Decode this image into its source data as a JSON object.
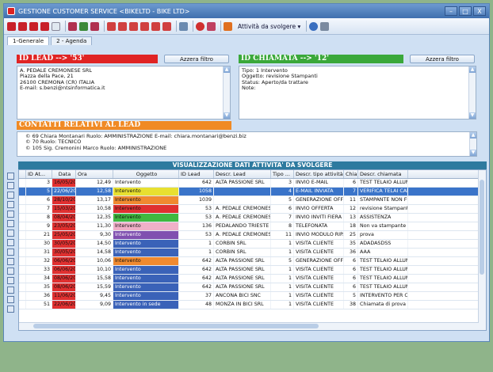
{
  "window": {
    "title": "GESTIONE CUSTOMER SERVICE <BIKELTD - BIKE LTD>",
    "min": "–",
    "max": "□",
    "close": "X"
  },
  "toolbar": {
    "menu_label": "Attività da svolgere ▾"
  },
  "tabs": [
    {
      "label": "1-Generale"
    },
    {
      "label": "2 - Agenda"
    }
  ],
  "id_lead": {
    "header": "ID LEAD --> '53'",
    "filter_label": "Azzera filtro",
    "lines": [
      "A. PEDALE CREMONESE SRL",
      "Piazza della Pace, 21",
      "26100 CREMONA (CR) ITALIA",
      "E-mail: s.benzi@ntsinformatica.it"
    ]
  },
  "id_chiamata": {
    "header": "ID CHIAMATA --> '12'",
    "filter_label": "Azzera filtro",
    "lines": [
      "Tipo: 1 Intervento",
      "Oggetto: revisione Stampanti",
      "Status: Aperto/da trattare",
      "Note:"
    ]
  },
  "contatti": {
    "header": "CONTATTI RELATIVI AL LEAD",
    "lines": [
      "69 Chiara  Montanari Ruolo: AMMINISTRAZIONE E-mail: chiara.montanari@benzi.biz",
      "70  Ruolo: TECNICO",
      "105 Sig. Cremonini Marco Ruolo: AMMINISTRAZIONE"
    ]
  },
  "grid": {
    "title": "VISUALIZZAZIONE DATI ATTIVITA' DA SVOLGERE",
    "columns": [
      "",
      "ID At...",
      "Data",
      "Ora",
      "Oggetto",
      "ID Lead",
      "Descr. Lead",
      "Tipo ...",
      "Descr. tipo attività",
      "Chia...",
      "Descr. chiamata"
    ],
    "rows": [
      {
        "id": "3",
        "data": "16/05/2012",
        "ora": "12,49",
        "oggetto": "Intervento",
        "idlead": "642",
        "lead": "ALTA PASSIONE SRL",
        "tipo": "3",
        "tipodesc": "INVIO E-MAIL",
        "chia": "6",
        "chiadesc": "TEST TELAIO ALLUMINIO",
        "datecolor": "#e03030",
        "ogcolor": ""
      },
      {
        "id": "5",
        "data": "22/06/2010",
        "ora": "12,58",
        "oggetto": "Intervento",
        "idlead": "1058",
        "lead": "",
        "tipo": "4",
        "tipodesc": "E-MAIL INVIATA",
        "chia": "7",
        "chiadesc": "VERIFICA TELAI CARBONI",
        "datecolor": "#e03030",
        "ogcolor": "#e8e030",
        "sel": true
      },
      {
        "id": "6",
        "data": "28/10/2010",
        "ora": "13,17",
        "oggetto": "Intervento",
        "idlead": "1039",
        "lead": "",
        "tipo": "5",
        "tipodesc": "GENERAZIONE OFFERTA",
        "chia": "11",
        "chiadesc": "STAMPANTE NON FUNZIO",
        "datecolor": "#e03030",
        "ogcolor": "#f08a30"
      },
      {
        "id": "7",
        "data": "15/03/2011",
        "ora": "10,58",
        "oggetto": "Intervento",
        "idlead": "53",
        "lead": "A. PEDALE CREMONESE SRL",
        "tipo": "6",
        "tipodesc": "INVIO OFFERTA",
        "chia": "12",
        "chiadesc": "revisione Stampanti",
        "datecolor": "#e03030",
        "ogcolor": "#e03030"
      },
      {
        "id": "8",
        "data": "08/04/2011",
        "ora": "12,35",
        "oggetto": "Intervento",
        "idlead": "53",
        "lead": "A. PEDALE CREMONESE SRL",
        "tipo": "7",
        "tipodesc": "INVIO INVITI FIERA",
        "chia": "13",
        "chiadesc": "ASSISTENZA",
        "datecolor": "#e03030",
        "ogcolor": "#40b840"
      },
      {
        "id": "9",
        "data": "23/05/2012",
        "ora": "11,30",
        "oggetto": "Intervento",
        "idlead": "136",
        "lead": "PEDALANDO TRIESTE SRL",
        "tipo": "8",
        "tipodesc": "TELEFONATA",
        "chia": "18",
        "chiadesc": "Non va stampante",
        "datecolor": "#e03030",
        "ogcolor": "#f0b0c8"
      },
      {
        "id": "21",
        "data": "25/05/2012",
        "ora": "9,30",
        "oggetto": "Intervento",
        "idlead": "53",
        "lead": "A. PEDALE CREMONESE SRL",
        "tipo": "11",
        "tipodesc": "INVIO MODULO RIPARAZION",
        "chia": "25",
        "chiadesc": "prova",
        "datecolor": "#e03030",
        "ogcolor": "#8050b0"
      },
      {
        "id": "30",
        "data": "30/05/2012",
        "ora": "14,50",
        "oggetto": "Intervento",
        "idlead": "1",
        "lead": "CORBIN SRL",
        "tipo": "1",
        "tipodesc": "VISITA CLIENTE",
        "chia": "35",
        "chiadesc": "ADADASDSS",
        "datecolor": "#e03030",
        "ogcolor": "#3a62b8"
      },
      {
        "id": "31",
        "data": "30/05/2012",
        "ora": "14,58",
        "oggetto": "Intervento",
        "idlead": "1",
        "lead": "CORBIN SRL",
        "tipo": "1",
        "tipodesc": "VISITA CLIENTE",
        "chia": "36",
        "chiadesc": "AAA",
        "datecolor": "#e03030",
        "ogcolor": "#3a62b8"
      },
      {
        "id": "32",
        "data": "06/06/2012",
        "ora": "10,06",
        "oggetto": "Intervento",
        "idlead": "642",
        "lead": "ALTA PASSIONE SRL",
        "tipo": "5",
        "tipodesc": "GENERAZIONE OFFERTA",
        "chia": "6",
        "chiadesc": "TEST TELAIO ALLUMINIO",
        "datecolor": "#e03030",
        "ogcolor": "#f08a30"
      },
      {
        "id": "33",
        "data": "06/06/2012",
        "ora": "10,10",
        "oggetto": "Intervento",
        "idlead": "642",
        "lead": "ALTA PASSIONE SRL",
        "tipo": "1",
        "tipodesc": "VISITA CLIENTE",
        "chia": "6",
        "chiadesc": "TEST TELAIO ALLUMINIO",
        "datecolor": "#e03030",
        "ogcolor": "#3a62b8"
      },
      {
        "id": "34",
        "data": "08/06/2012",
        "ora": "15,58",
        "oggetto": "Intervento",
        "idlead": "642",
        "lead": "ALTA PASSIONE SRL",
        "tipo": "1",
        "tipodesc": "VISITA CLIENTE",
        "chia": "6",
        "chiadesc": "TEST TELAIO ALLUMINIO",
        "datecolor": "#e03030",
        "ogcolor": "#3a62b8"
      },
      {
        "id": "35",
        "data": "08/06/2012",
        "ora": "15,59",
        "oggetto": "Intervento",
        "idlead": "642",
        "lead": "ALTA PASSIONE SRL",
        "tipo": "1",
        "tipodesc": "VISITA CLIENTE",
        "chia": "6",
        "chiadesc": "TEST TELAIO ALLUMINIO",
        "datecolor": "#e03030",
        "ogcolor": "#3a62b8"
      },
      {
        "id": "36",
        "data": "11/06/2012",
        "ora": "9,45",
        "oggetto": "Intervento",
        "idlead": "37",
        "lead": "ANCONA BICI SNC",
        "tipo": "1",
        "tipodesc": "VISITA CLIENTE",
        "chia": "5",
        "chiadesc": "INTERVENTO PER CABLAG",
        "datecolor": "#e03030",
        "ogcolor": "#3a62b8"
      },
      {
        "id": "51",
        "data": "22/06/2012",
        "ora": "9,09",
        "oggetto": "Intervento in sede",
        "idlead": "48",
        "lead": "MONZA IN BICI SRL",
        "tipo": "1",
        "tipodesc": "VISITA CLIENTE",
        "chia": "38",
        "chiadesc": "Chiamata di prova",
        "datecolor": "#e03030",
        "ogcolor": "#3a62b8"
      }
    ]
  }
}
